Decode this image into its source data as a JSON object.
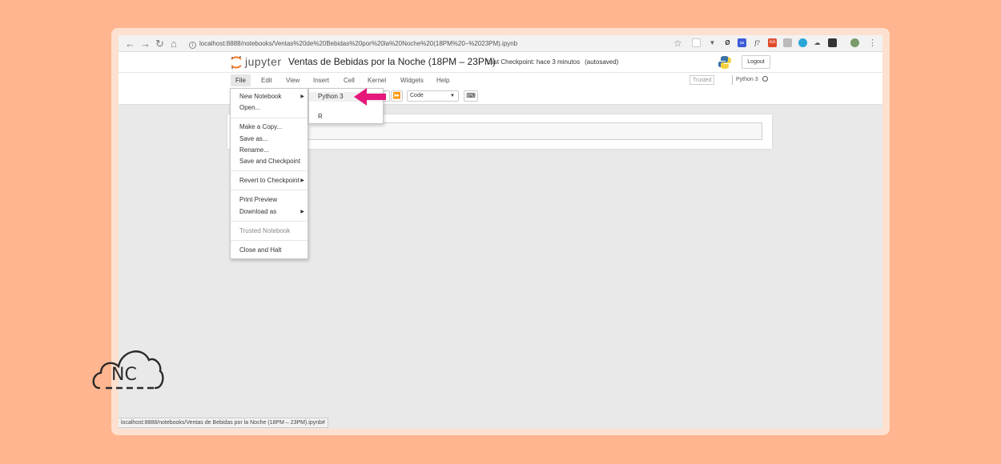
{
  "browser": {
    "url": "localhost:8888/notebooks/Ventas%20de%20Bebidas%20por%20la%20Noche%20(18PM%20–%2023PM).ipynb",
    "status_bar_url": "localhost:8888/notebooks/Ventas de Bebidas por la Noche (18PM – 23PM).ipynb#"
  },
  "header": {
    "logo_text": "jupyter",
    "notebook_title": "Ventas de Bebidas por la Noche (18PM – 23PM)",
    "checkpoint": "Last Checkpoint: hace 3 minutos",
    "autosaved": "(autosaved)",
    "logout_label": "Logout"
  },
  "menubar": {
    "items": [
      "File",
      "Edit",
      "View",
      "Insert",
      "Cell",
      "Kernel",
      "Widgets",
      "Help"
    ],
    "trusted": "Trusted",
    "kernel": "Python 3"
  },
  "toolbar": {
    "cell_type": "Code"
  },
  "file_menu": {
    "items": [
      {
        "label": "New Notebook",
        "submenu": true
      },
      {
        "label": "Open..."
      },
      {
        "label": "Make a Copy..."
      },
      {
        "label": "Save as..."
      },
      {
        "label": "Rename..."
      },
      {
        "label": "Save and Checkpoint"
      },
      {
        "label": "Revert to Checkpoint",
        "submenu": true
      },
      {
        "label": "Print Preview"
      },
      {
        "label": "Download as",
        "submenu": true
      },
      {
        "label": "Trusted Notebook",
        "disabled": true
      },
      {
        "label": "Close and Halt"
      }
    ]
  },
  "new_notebook_submenu": {
    "items": [
      "Python 3",
      "R"
    ]
  },
  "watermark": {
    "text": "NC"
  },
  "colors": {
    "background": "#ffb58f",
    "arrow": "#e5177b",
    "jupyter_orange": "#f37726"
  }
}
